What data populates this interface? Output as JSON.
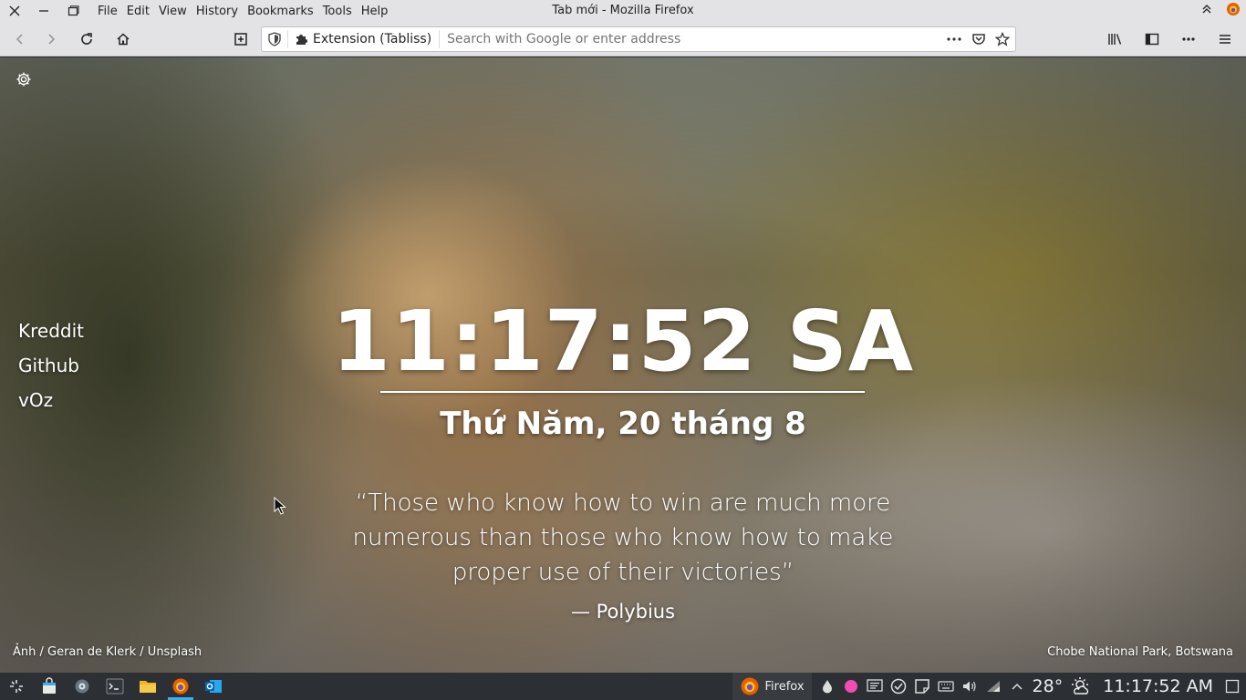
{
  "window": {
    "title": "Tab mới - Mozilla Firefox",
    "menu": [
      "File",
      "Edit",
      "View",
      "History",
      "Bookmarks",
      "Tools",
      "Help"
    ]
  },
  "urlbar": {
    "extension_label": "Extension (Tabliss)",
    "placeholder": "Search with Google or enter address"
  },
  "page": {
    "links": [
      "Kreddit",
      "Github",
      "vOz"
    ],
    "time": "11:17:52 SA",
    "date": "Thứ Năm, 20 tháng 8",
    "quote": "“Those who know how to win are much more numerous than those who know how to make proper use of their victories”",
    "author": "— Polybius",
    "photo_credit": "Ảnh / Geran de Klerk / Unsplash",
    "location": "Chobe National Park, Botswana"
  },
  "taskbar": {
    "task_label": "Firefox",
    "temperature": "28°",
    "clock": "11:17:52 AM"
  },
  "colors": {
    "taskbar": "#2c3035",
    "chrome": "#e3e3e5",
    "accent": "#3daee9"
  }
}
